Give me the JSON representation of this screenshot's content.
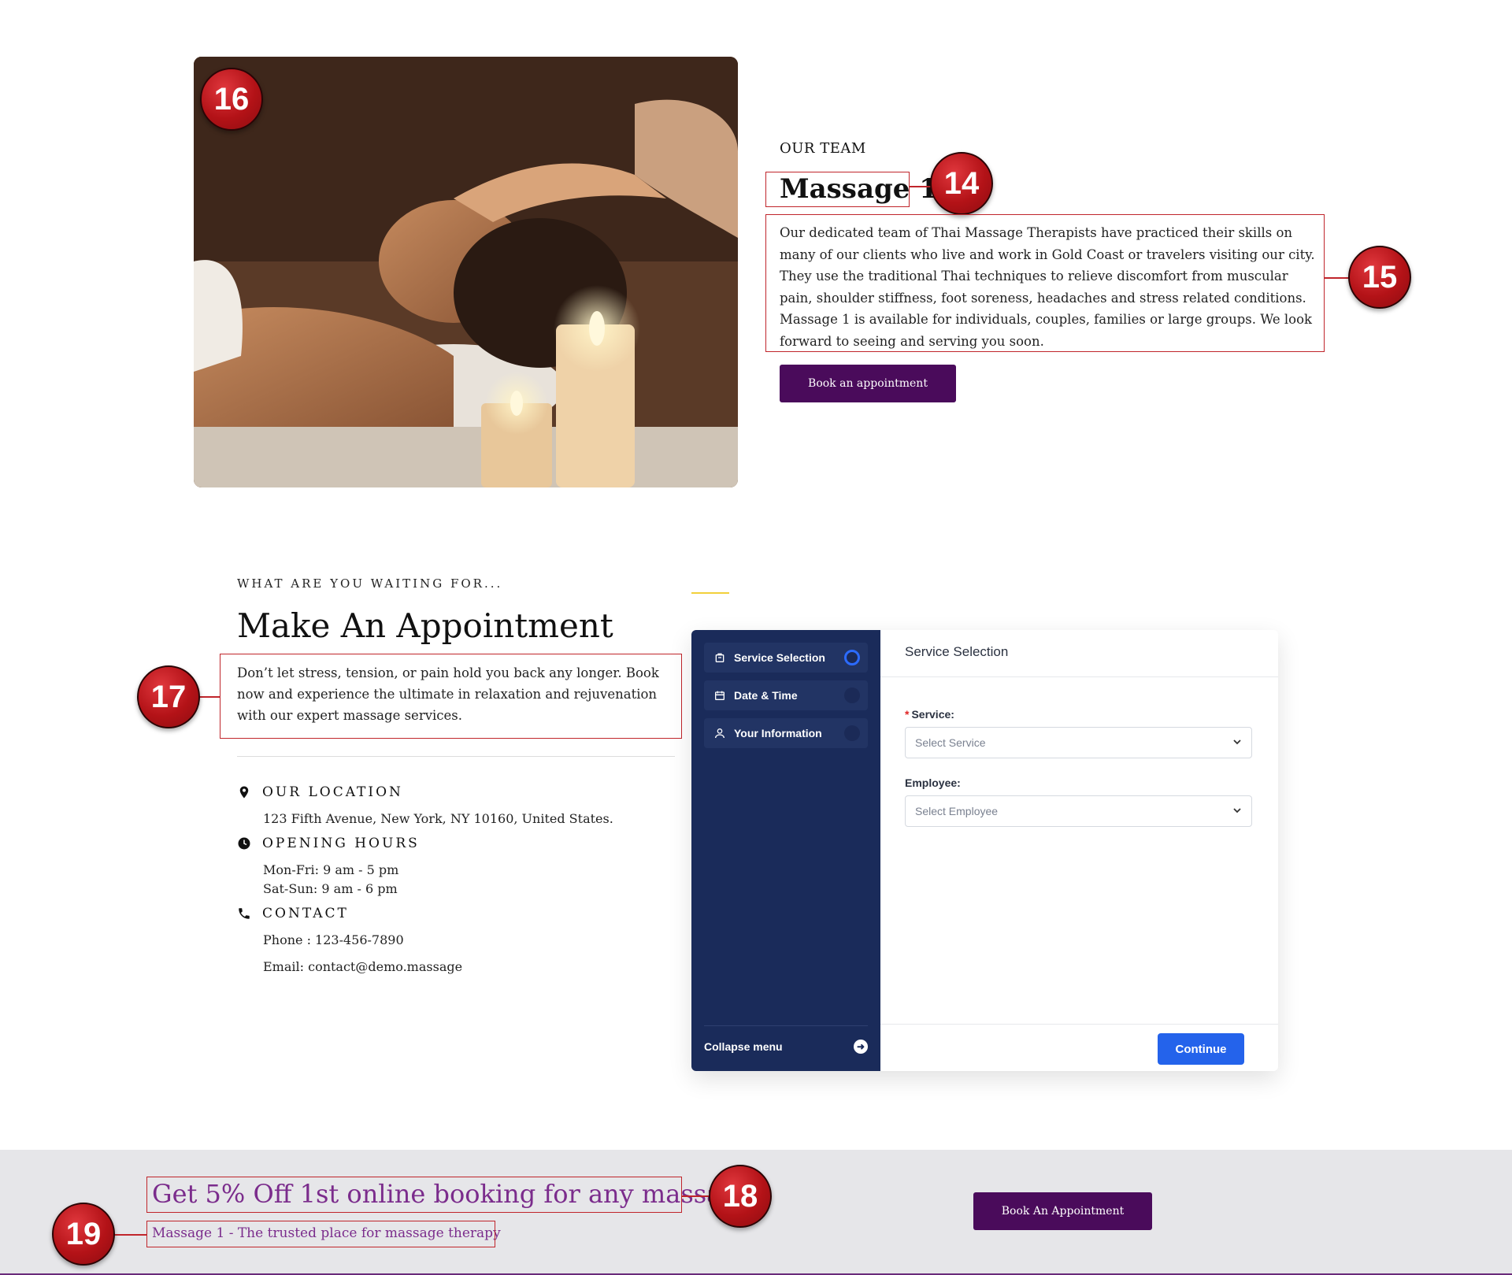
{
  "team": {
    "eyebrow": "OUR TEAM",
    "title": "Massage 1",
    "description": "Our dedicated team of Thai Massage Therapists have practiced their skills on many of our clients who live and work in Gold Coast or travelers visiting our city. They use the traditional Thai techniques to relieve discomfort from muscular pain, shoulder stiffness, foot soreness, headaches and stress related conditions. Massage 1 is available for individuals, couples, families or large groups. We look forward to seeing and serving you soon.",
    "button_label": "Book an appointment"
  },
  "appointment": {
    "eyebrow": "WHAT ARE YOU WAITING FOR...",
    "title": "Make An Appointment",
    "description": "Don’t let stress, tension, or pain hold you back any longer. Book now and experience the ultimate in relaxation and rejuvenation with our expert massage services.",
    "location_heading": "OUR LOCATION",
    "location_text": "123 Fifth Avenue, New York, NY 10160, United States.",
    "hours_heading": "OPENING HOURS",
    "hours_weekday": "Mon-Fri: 9 am - 5 pm",
    "hours_weekend": "Sat-Sun: 9 am - 6 pm",
    "contact_heading": "CONTACT",
    "phone": "Phone : 123-456-7890",
    "email": "Email: contact@demo.massage"
  },
  "widget": {
    "steps": [
      {
        "label": "Service Selection",
        "icon": "bag-icon",
        "active": true
      },
      {
        "label": "Date & Time",
        "icon": "calendar-icon",
        "active": false
      },
      {
        "label": "Your Information",
        "icon": "user-icon",
        "active": false
      }
    ],
    "collapse_label": "Collapse menu",
    "header": "Service Selection",
    "service_label": "Service:",
    "service_required_mark": "*",
    "service_placeholder": "Select Service",
    "employee_label": "Employee:",
    "employee_placeholder": "Select Employee",
    "continue_label": "Continue"
  },
  "promo": {
    "title": "Get 5% Off 1st online booking for any massage.",
    "subtitle": "Massage 1 - The trusted place for massage therapy",
    "button_label": "Book An Appointment"
  },
  "annotations": [
    "14",
    "15",
    "16",
    "17",
    "18",
    "19"
  ],
  "colors": {
    "brand_purple": "#4a0b5b",
    "widget_navy": "#1a2b5a",
    "continue_blue": "#2463eb",
    "promo_text": "#7b2c8c",
    "annotation_red": "#c0252b"
  }
}
